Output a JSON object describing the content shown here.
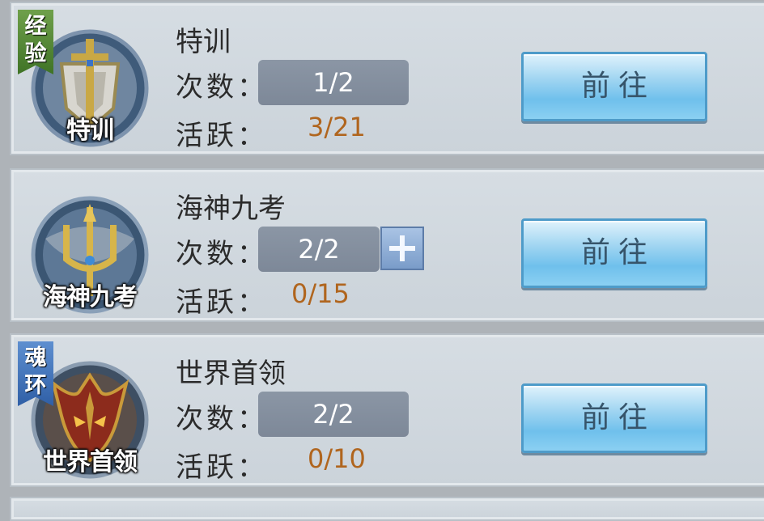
{
  "activities": [
    {
      "tag": "经验",
      "emblem_label": "特训",
      "title": "特训",
      "count_label": "次数：",
      "count_value": "1/2",
      "active_label": "活跃：",
      "active_value": "3/21",
      "button_label": "前往"
    },
    {
      "tag": "",
      "emblem_label": "海神九考",
      "title": "海神九考",
      "count_label": "次数：",
      "count_value": "2/2",
      "active_label": "活跃：",
      "active_value": "0/15",
      "button_label": "前往"
    },
    {
      "tag": "魂环",
      "emblem_label": "世界首领",
      "title": "世界首领",
      "count_label": "次数：",
      "count_value": "2/2",
      "active_label": "活跃：",
      "active_value": "0/10",
      "button_label": "前往"
    }
  ],
  "icons": {
    "training": "sword-shield-icon",
    "trial": "trident-icon",
    "boss": "demon-mask-icon",
    "add": "plus-icon"
  },
  "colors": {
    "active_value": "#b0651e",
    "go_button": "#8fd0f2",
    "count_box": "#8792a1",
    "tag_green": "#4f8a33",
    "tag_blue": "#3e6db3"
  }
}
